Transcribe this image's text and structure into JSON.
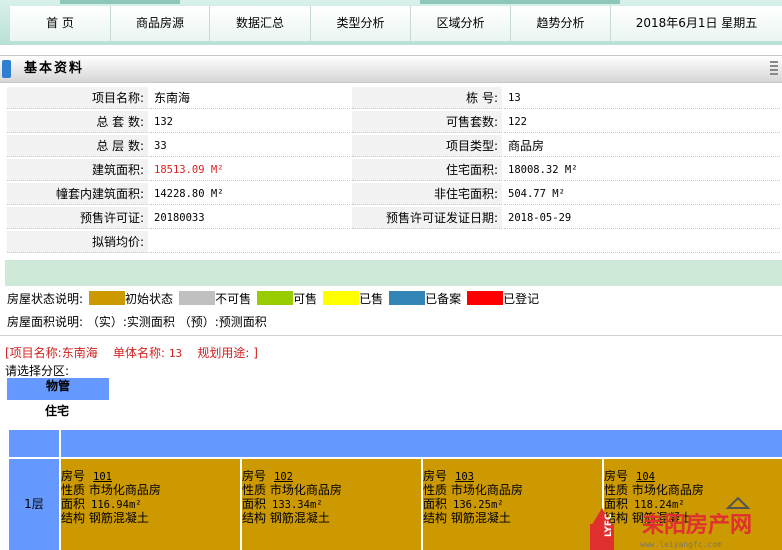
{
  "nav": {
    "items": [
      "首 页",
      "商品房源",
      "数据汇总",
      "类型分析",
      "区域分析",
      "趋势分析"
    ],
    "date": "2018年6月1日  星期五"
  },
  "section": {
    "title": "基本资料"
  },
  "info": {
    "rows": [
      {
        "l1": "项目名称:",
        "v1": "东南海",
        "l2": "栋    号:",
        "v2": "13"
      },
      {
        "l1": "总 套 数:",
        "v1": "132",
        "l2": "可售套数:",
        "v2": "122"
      },
      {
        "l1": "总 层 数:",
        "v1": "33",
        "l2": "项目类型:",
        "v2": "商品房"
      },
      {
        "l1": "建筑面积:",
        "v1": "18513.09 M²",
        "l2": "住宅面积:",
        "v2": "18008.32 M²"
      },
      {
        "l1": "幢套内建筑面积:",
        "v1": "14228.80 M²",
        "l2": "非住宅面积:",
        "v2": "504.77 M²"
      },
      {
        "l1": "预售许可证:",
        "v1": "20180033",
        "l2": "预售许可证发证日期:",
        "v2": "2018-05-29"
      },
      {
        "l1": "拟销均价:",
        "v1": "",
        "l2": "",
        "v2": ""
      }
    ]
  },
  "legend": {
    "label": "房屋状态说明:",
    "items": [
      {
        "name": "初始状态",
        "color": "#cc9900"
      },
      {
        "name": "不可售",
        "color": "#c0c0c0"
      },
      {
        "name": "可售",
        "color": "#99cc00"
      },
      {
        "name": "已售",
        "color": "#ffff00"
      },
      {
        "name": "已备案",
        "color": "#3385b5"
      },
      {
        "name": "已登记",
        "color": "#ff0000"
      }
    ],
    "area_note": "房屋面积说明: （实）:实测面积 （预）:预测面积"
  },
  "project": {
    "name_label": "[项目名称:",
    "name": "东南海",
    "unit_label": "单体名称:",
    "unit": "13",
    "use_label": "规划用途:",
    "use": "]"
  },
  "zone": {
    "prompt": "请选择分区:",
    "tab": "物管",
    "sub": "住宅"
  },
  "grid": {
    "floor": "1层",
    "units": [
      {
        "room": "101",
        "nature": "市场化商品房",
        "area": "116.94m²",
        "structure": "钢筋混凝土"
      },
      {
        "room": "102",
        "nature": "市场化商品房",
        "area": "133.34m²",
        "structure": "钢筋混凝土"
      },
      {
        "room": "103",
        "nature": "市场化商品房",
        "area": "136.25m²",
        "structure": "钢筋混凝土"
      },
      {
        "room": "104",
        "nature": "市场化商品房",
        "area": "118.24m²",
        "structure": "钢筋混凝土"
      }
    ],
    "labels": {
      "room": "房号",
      "nature": "性质",
      "area": "面积",
      "structure": "结构"
    }
  },
  "watermark": {
    "badge": "LYFC",
    "text": "耒阳房产网",
    "url": "www.leiyangfc.com"
  }
}
